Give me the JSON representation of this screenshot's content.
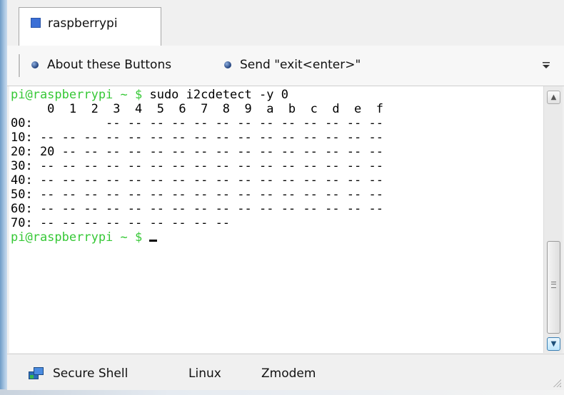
{
  "tabbar": {
    "tab_label": "raspberrypi"
  },
  "toolbar": {
    "buttons": [
      {
        "label": "About these Buttons"
      },
      {
        "label": "Send \"exit<enter>\""
      }
    ],
    "overflow_icon": "chevron-overflow-icon"
  },
  "terminal": {
    "prompt": "pi@raspberrypi ~ $",
    "command": " sudo i2cdetect -y 0",
    "lines": [
      "     0  1  2  3  4  5  6  7  8  9  a  b  c  d  e  f",
      "00:          -- -- -- -- -- -- -- -- -- -- -- -- --",
      "10: -- -- -- -- -- -- -- -- -- -- -- -- -- -- -- --",
      "20: 20 -- -- -- -- -- -- -- -- -- -- -- -- -- -- --",
      "30: -- -- -- -- -- -- -- -- -- -- -- -- -- -- -- --",
      "40: -- -- -- -- -- -- -- -- -- -- -- -- -- -- -- --",
      "50: -- -- -- -- -- -- -- -- -- -- -- -- -- -- -- --",
      "60: -- -- -- -- -- -- -- -- -- -- -- -- -- -- -- --",
      "70: -- -- -- -- -- -- -- -- --"
    ],
    "prompt2": "pi@raspberrypi ~ $",
    "prompt_color": "#36c836"
  },
  "statusbar": {
    "items": [
      {
        "label": "Secure Shell"
      },
      {
        "label": "Linux"
      },
      {
        "label": "Zmodem"
      }
    ]
  }
}
